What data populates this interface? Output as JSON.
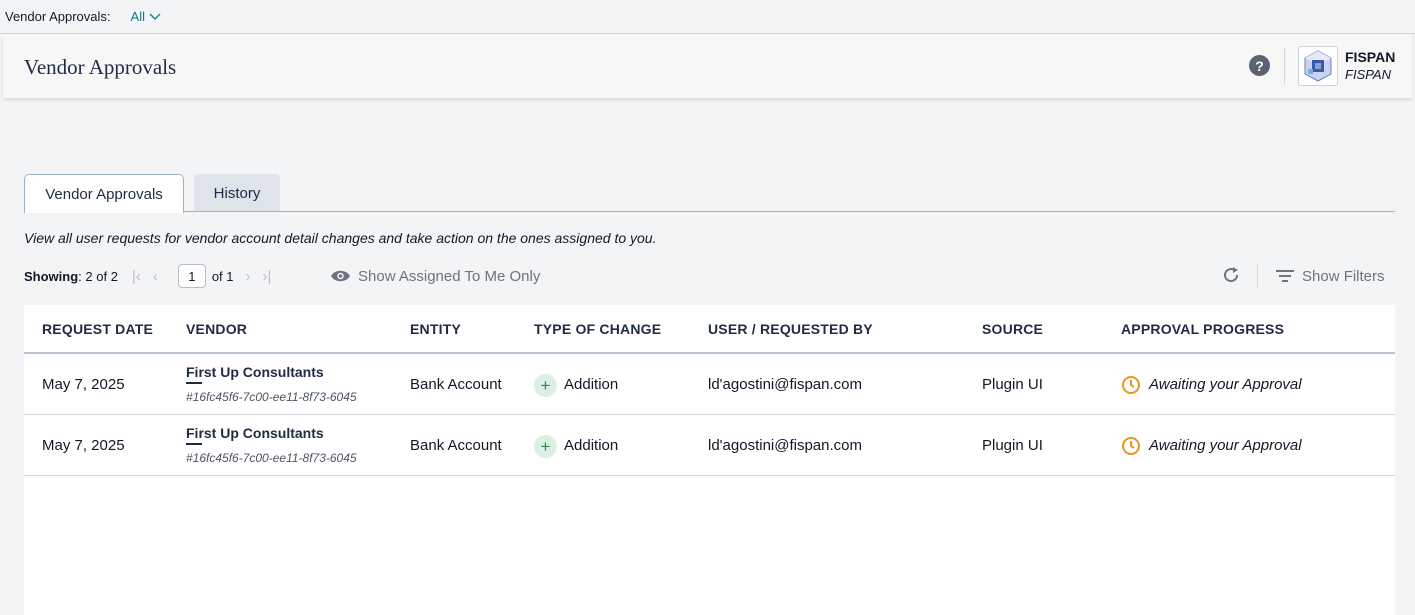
{
  "filter_bar": {
    "label": "Vendor Approvals:",
    "value": "All"
  },
  "header": {
    "title": "Vendor Approvals",
    "help_label": "?",
    "brand_name": "FISPAN",
    "brand_sub": "FISPAN"
  },
  "tabs": [
    {
      "label": "Vendor Approvals",
      "active": true
    },
    {
      "label": "History",
      "active": false
    }
  ],
  "description": "View all user requests for vendor account detail changes and take action on the ones assigned to you.",
  "pager": {
    "showing_label": "Showing",
    "showing_value": ": 2 of 2",
    "page": "1",
    "of_pages": "of 1"
  },
  "toolbar": {
    "assigned_label": "Show Assigned To Me Only",
    "filters_label": "Show Filters"
  },
  "table": {
    "columns": [
      "REQUEST DATE",
      "VENDOR",
      "ENTITY",
      "TYPE OF CHANGE",
      "USER / REQUESTED BY",
      "SOURCE",
      "APPROVAL PROGRESS"
    ],
    "rows": [
      {
        "date": "May 7, 2025",
        "vendor": "First Up Consultants",
        "vendor_id": "#16fc45f6-7c00-ee11-8f73-6045",
        "entity": "Bank Account",
        "change": "Addition",
        "user": "ld'agostini@fispan.com",
        "source": "Plugin UI",
        "progress": "Awaiting your Approval"
      },
      {
        "date": "May 7, 2025",
        "vendor": "First Up Consultants",
        "vendor_id": "#16fc45f6-7c00-ee11-8f73-6045",
        "entity": "Bank Account",
        "change": "Addition",
        "user": "ld'agostini@fispan.com",
        "source": "Plugin UI",
        "progress": "Awaiting your Approval"
      }
    ]
  },
  "colors": {
    "accent_teal": "#0f7a8a",
    "navy": "#1f2a44",
    "status_orange": "#e8961f",
    "addition_green": "#2f8a4b"
  },
  "icons": {
    "help": "question-circle-icon",
    "refresh": "refresh-icon",
    "filter": "filter-lines-icon",
    "eye": "eye-icon",
    "clock": "clock-icon",
    "plus": "plus-icon"
  }
}
